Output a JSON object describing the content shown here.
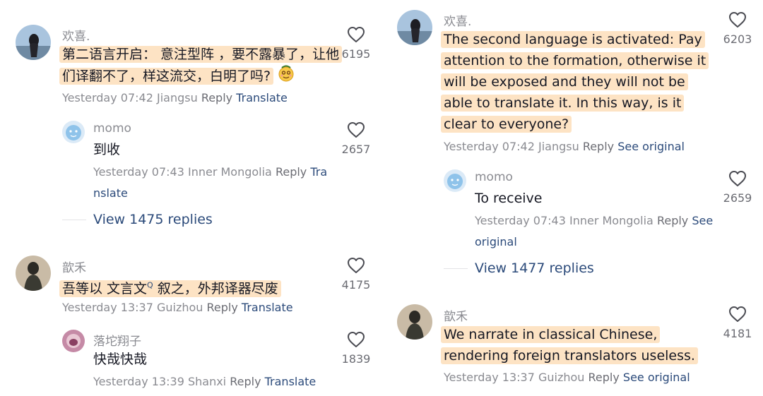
{
  "left": {
    "c1": {
      "username": "欢喜.",
      "text": "第二语言开启： 意注型阵 ，要不露暴了，让他们译翻不了，样这流交，白明了吗?",
      "time": "Yesterday 07:42",
      "location": "Jiangsu",
      "reply": "Reply",
      "action": "Translate",
      "likes": "6195",
      "emoji": "smiling-face-with-spiral-eyes"
    },
    "c1r": {
      "username": "momo",
      "text": "到收",
      "time": "Yesterday 07:43",
      "location": "Inner Mongolia",
      "reply": "Reply",
      "action": "Translate",
      "likes": "2657"
    },
    "view_replies": "View 1475 replies",
    "c2": {
      "username": "歆禾",
      "text": "吾等以 文言文",
      "text_sup": "Q",
      "text_after": " 叙之，外邦译器尽废",
      "time": "Yesterday 13:37",
      "location": "Guizhou",
      "reply": "Reply",
      "action": "Translate",
      "likes": "4175"
    },
    "c2r": {
      "username": "落坨翔子",
      "text": "快哉快哉",
      "time": "Yesterday 13:39",
      "location": "Shanxi",
      "reply": "Reply",
      "action": "Translate",
      "likes": "1839"
    }
  },
  "right": {
    "c1": {
      "username": "欢喜.",
      "text": "The second language is activated: Pay attention to the formation, otherwise it will be exposed and they will not be able to translate it. In this way, is it clear to everyone?",
      "time": "Yesterday 07:42",
      "location": "Jiangsu",
      "reply": "Reply",
      "action": "See original",
      "likes": "6203"
    },
    "c1r": {
      "username": "momo",
      "text": "To receive",
      "time": "Yesterday 07:43",
      "location": "Inner Mongolia",
      "reply": "Reply",
      "action": "See original",
      "likes": "2659"
    },
    "view_replies": "View 1477 replies",
    "c2": {
      "username": "歆禾",
      "text": "We narrate in classical Chinese, rendering foreign translators useless.",
      "time": "Yesterday 13:37",
      "location": "Guizhou",
      "reply": "Reply",
      "action": "See original",
      "likes": "4181"
    }
  },
  "icons": {
    "like": "heart-outline-icon"
  },
  "colors": {
    "highlight": "#fde3c4",
    "link": "#2b4a7a",
    "meta": "#8a8b91"
  }
}
